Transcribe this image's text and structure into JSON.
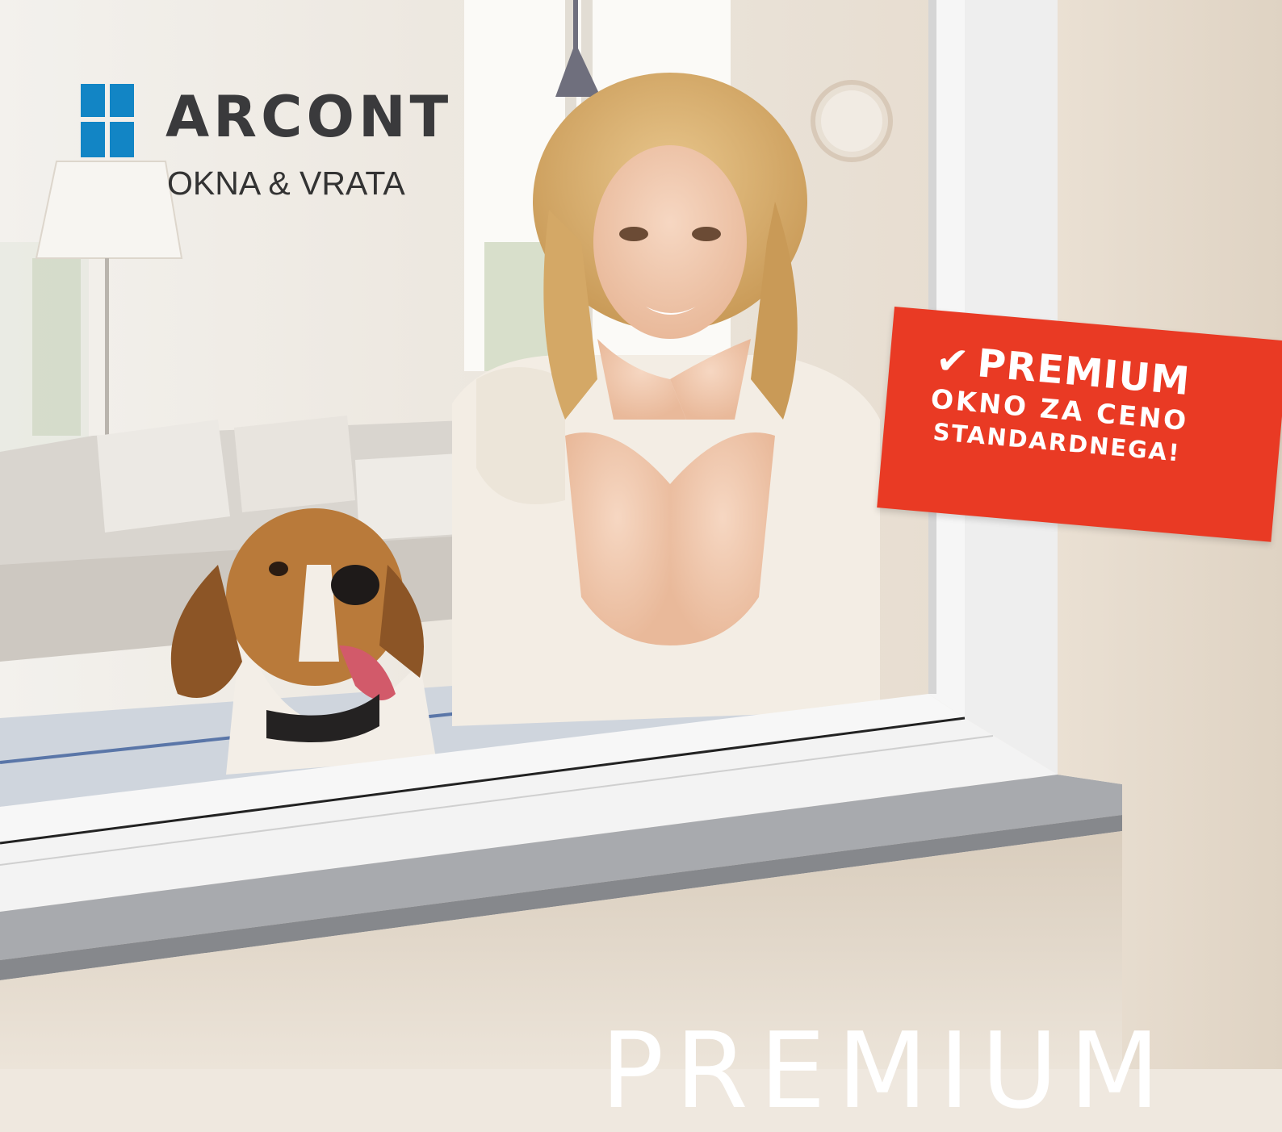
{
  "brand": {
    "name": "ARCONT",
    "tagline": "OKNA & VRATA",
    "logo_color": "#1285c5"
  },
  "badge": {
    "icon": "checkmark-icon",
    "title": "PREMIUM",
    "line2": "OKNO ZA CENO",
    "line3": "STANDARDNEGA!",
    "color": "#e93a24"
  },
  "headline": "PREMIUM"
}
